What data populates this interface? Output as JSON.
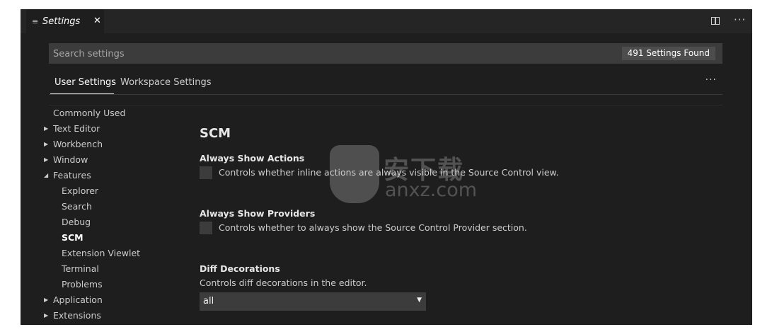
{
  "tab": {
    "menu_icon": "≡",
    "title": "Settings",
    "close_icon": "✕"
  },
  "toolbar": {
    "split_icon": "split-editor-icon",
    "more": "···"
  },
  "search": {
    "placeholder": "Search settings",
    "value": "",
    "count": "491 Settings Found"
  },
  "settings_tabs": {
    "user": "User Settings",
    "workspace": "Workspace Settings",
    "more": "···"
  },
  "toc": {
    "items": [
      {
        "label": "Commonly Used",
        "arrow": ""
      },
      {
        "label": "Text Editor",
        "arrow": "▶"
      },
      {
        "label": "Workbench",
        "arrow": "▶"
      },
      {
        "label": "Window",
        "arrow": "▶"
      },
      {
        "label": "Features",
        "arrow": "◢"
      },
      {
        "label": "Explorer"
      },
      {
        "label": "Search"
      },
      {
        "label": "Debug"
      },
      {
        "label": "SCM"
      },
      {
        "label": "Extension Viewlet"
      },
      {
        "label": "Terminal"
      },
      {
        "label": "Problems"
      },
      {
        "label": "Application",
        "arrow": "▶"
      },
      {
        "label": "Extensions",
        "arrow": "▶"
      }
    ]
  },
  "content": {
    "section_title": "SCM",
    "settings": [
      {
        "name": "Always Show Actions",
        "description": "Controls whether inline actions are always visible in the Source Control view.",
        "checked": false
      },
      {
        "name": "Always Show Providers",
        "description": "Controls whether to always show the Source Control Provider section.",
        "checked": false
      },
      {
        "name": "Diff Decorations",
        "description": "Controls diff decorations in the editor.",
        "value": "all",
        "dropdown_arrow": "▼"
      }
    ]
  },
  "watermark": {
    "cn": "安下载",
    "en": "anxz.com"
  }
}
